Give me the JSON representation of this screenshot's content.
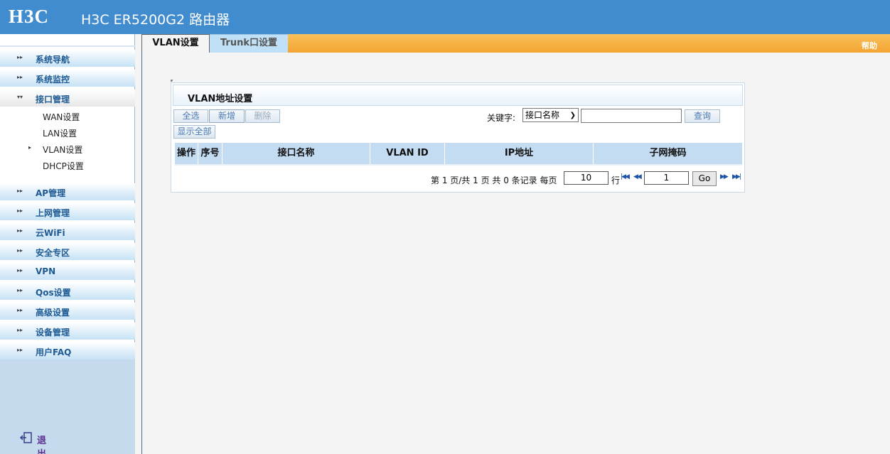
{
  "header": {
    "logo": "H3C",
    "title": "H3C ER5200G2 路由器"
  },
  "sidebar": {
    "menu": [
      {
        "label": "系统导航"
      },
      {
        "label": "系统监控"
      },
      {
        "label": "接口管理"
      },
      {
        "label": "AP管理"
      },
      {
        "label": "上网管理"
      },
      {
        "label": "云WiFi"
      },
      {
        "label": "安全专区"
      },
      {
        "label": "VPN"
      },
      {
        "label": "Qos设置"
      },
      {
        "label": "高级设置"
      },
      {
        "label": "设备管理"
      },
      {
        "label": "用户FAQ"
      }
    ],
    "submenu": [
      {
        "label": "WAN设置"
      },
      {
        "label": "LAN设置"
      },
      {
        "label": "VLAN设置"
      },
      {
        "label": "DHCP设置"
      }
    ],
    "logout": "退出"
  },
  "tabs": {
    "active": "VLAN设置",
    "inactive": "Trunk口设置",
    "help": "帮助"
  },
  "panel": {
    "title": "VLAN地址设置",
    "buttons": {
      "select_all": "全选",
      "add": "新增",
      "delete": "删除",
      "show_all": "显示全部",
      "search": "查询"
    },
    "keyword_label": "关键字:",
    "keyword_option": "接口名称",
    "keyword_value": "",
    "columns": [
      "操作",
      "序号",
      "接口名称",
      "VLAN ID",
      "IP地址",
      "子网掩码"
    ]
  },
  "pager": {
    "text_page": "第 1 页/共 1 页 共 0 条记录 每页",
    "per_page": "10",
    "rows_label": "行",
    "page_input": "1",
    "go": "Go"
  },
  "colors": {
    "header": "#418bcf",
    "tab_bar": "#f3a431",
    "menu_text": "#1e5a94",
    "table_head": "#c3dcf1"
  }
}
